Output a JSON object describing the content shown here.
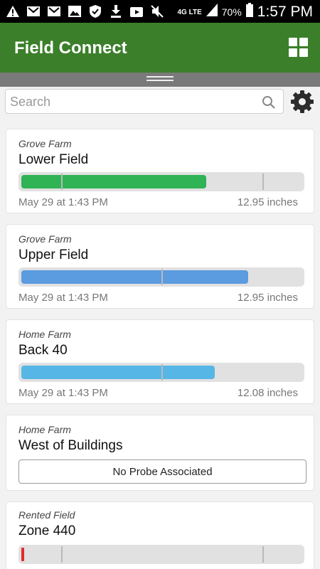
{
  "status_bar": {
    "network_label": "4G LTE",
    "battery": "70%",
    "time": "1:57 PM"
  },
  "app": {
    "title": "Field Connect"
  },
  "search": {
    "placeholder": "Search",
    "value": ""
  },
  "fields": [
    {
      "farm": "Grove Farm",
      "name": "Lower Field",
      "date": "May 29 at 1:43 PM",
      "amount": "12.95 inches",
      "fill_fraction": 0.66,
      "color": "#2fb354"
    },
    {
      "farm": "Grove Farm",
      "name": "Upper Field",
      "date": "May 29 at 1:43 PM",
      "amount": "12.95 inches",
      "fill_fraction": 0.81,
      "color": "#5b9be0"
    },
    {
      "farm": "Home Farm",
      "name": "Back 40",
      "date": "May 29 at 1:43 PM",
      "amount": "12.08 inches",
      "fill_fraction": 0.69,
      "color": "#56b6e6"
    },
    {
      "farm": "Home Farm",
      "name": "West of Buildings",
      "no_probe_label": "No Probe Associated"
    },
    {
      "farm": "Rented Field",
      "name": "Zone 440",
      "fill_fraction": 0.01,
      "color": "#e22b2b"
    }
  ]
}
